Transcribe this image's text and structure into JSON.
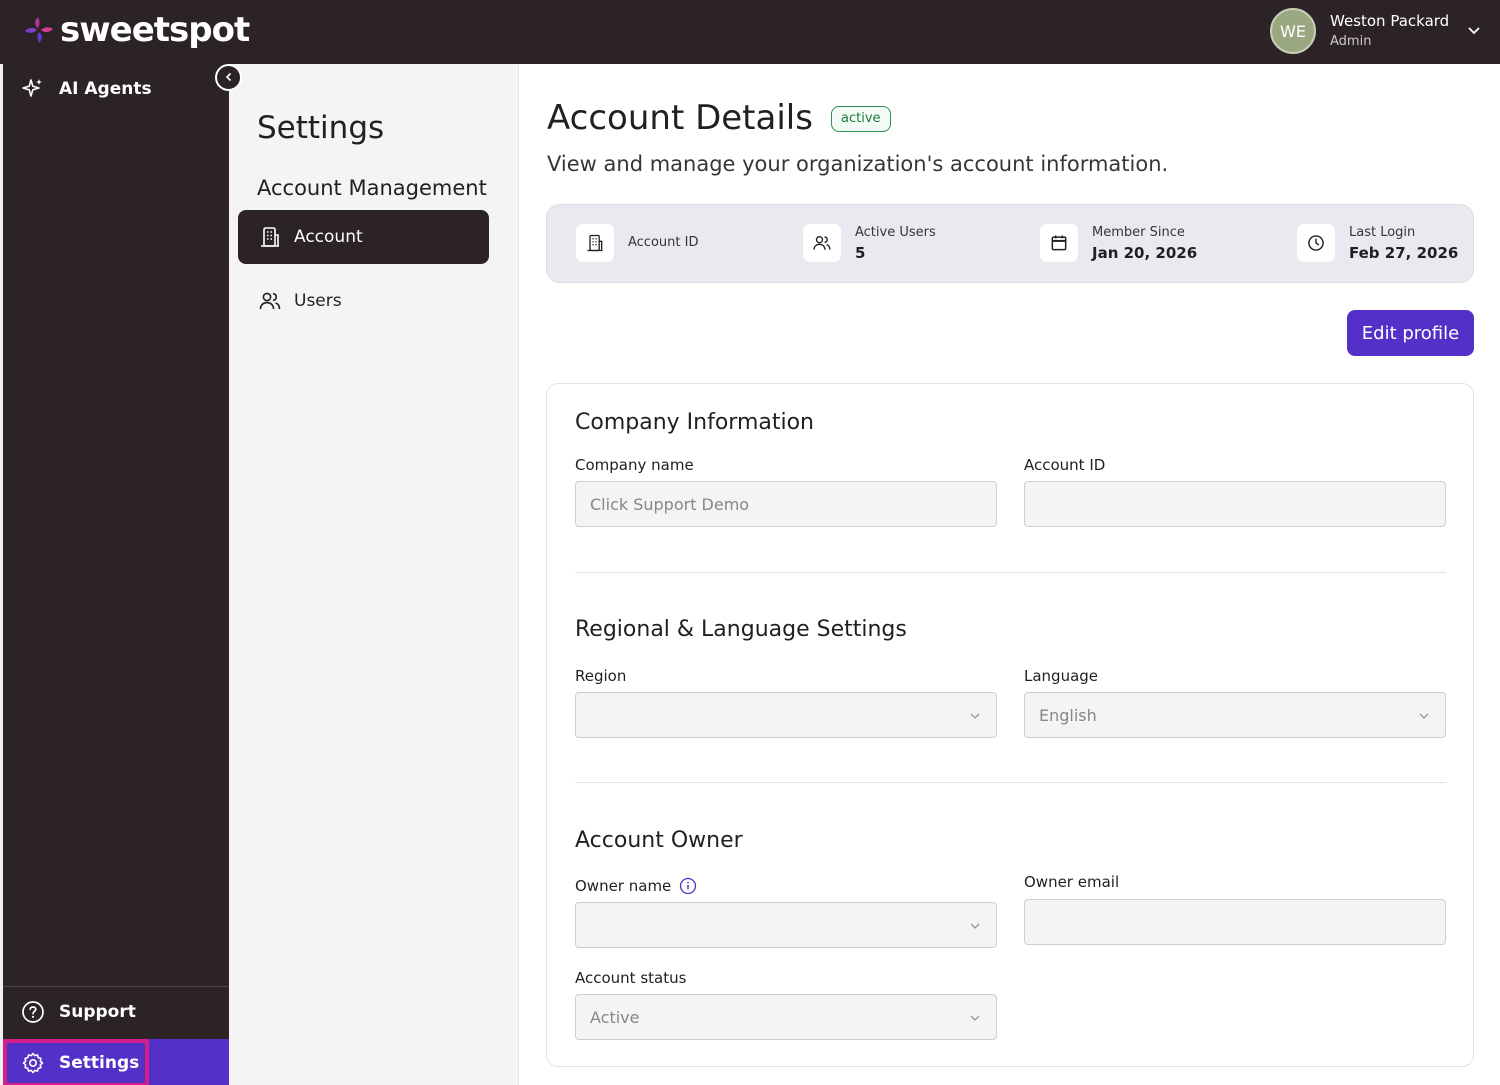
{
  "brand": {
    "name": "sweetspot",
    "accent": "#5331c9",
    "highlight": "#d21f8a"
  },
  "user": {
    "initials": "WE",
    "name": "Weston Packard",
    "role": "Admin"
  },
  "sidebar": {
    "items": [
      {
        "label": "AI Agents",
        "icon": "sparkle-icon"
      },
      {
        "label": "Support",
        "icon": "help-circle-icon"
      },
      {
        "label": "Settings",
        "icon": "gear-icon"
      }
    ]
  },
  "settings_nav": {
    "title": "Settings",
    "section": "Account Management",
    "items": [
      {
        "label": "Account",
        "icon": "building-icon",
        "active": true
      },
      {
        "label": "Users",
        "icon": "users-icon",
        "active": false
      }
    ]
  },
  "page": {
    "title": "Account Details",
    "status": "active",
    "subtitle": "View and manage your organization's account information."
  },
  "stats": [
    {
      "label": "Account ID",
      "value": "",
      "icon": "building-icon"
    },
    {
      "label": "Active Users",
      "value": "5",
      "icon": "users-icon"
    },
    {
      "label": "Member Since",
      "value": "Jan 20, 2026",
      "icon": "calendar-icon"
    },
    {
      "label": "Last Login",
      "value": "Feb 27, 2026",
      "icon": "clock-icon"
    }
  ],
  "edit_button": "Edit profile",
  "company": {
    "title": "Company Information",
    "name_label": "Company name",
    "name_placeholder": "Click Support Demo",
    "account_id_label": "Account ID",
    "account_id_value": ""
  },
  "regional": {
    "title": "Regional & Language Settings",
    "region_label": "Region",
    "region_value": "",
    "language_label": "Language",
    "language_value": "English"
  },
  "owner": {
    "title": "Account Owner",
    "name_label": "Owner name",
    "name_value": "",
    "email_label": "Owner email",
    "email_value": "",
    "status_label": "Account status",
    "status_value": "Active"
  }
}
